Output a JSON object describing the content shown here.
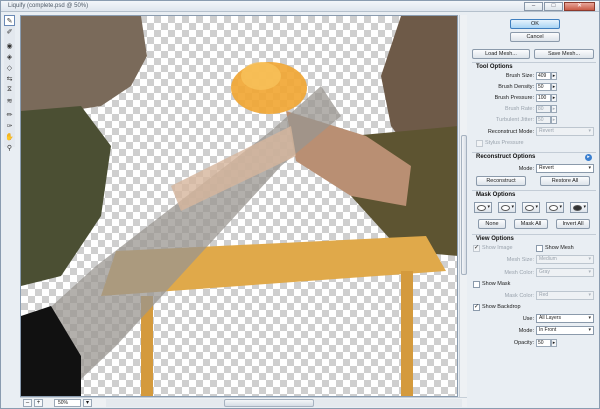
{
  "window": {
    "title": "Liquify (complete.psd @ 50%)",
    "minimize": "–",
    "maximize": "□",
    "close": "✕"
  },
  "toolbox": {
    "tools": [
      "forward-warp",
      "reconstruct",
      "twirl-clockwise",
      "pucker",
      "bloat",
      "push-left",
      "mirror",
      "turbulence",
      "freeze-mask",
      "thaw-mask",
      "hand",
      "zoom"
    ],
    "glyphs": [
      "✎",
      "✐",
      "◉",
      "◈",
      "◇",
      "⇆",
      "⧖",
      "≋",
      "✏",
      "✑",
      "✋",
      "⚲"
    ]
  },
  "status": {
    "zoom_out": "–",
    "zoom_in": "+",
    "zoom_value": "50%",
    "dropdown": "▾"
  },
  "panel": {
    "ok": "OK",
    "cancel": "Cancel",
    "load_mesh": "Load Mesh...",
    "save_mesh": "Save Mesh...",
    "tool_options": {
      "title": "Tool Options",
      "brush_size_label": "Brush Size:",
      "brush_size": "409",
      "brush_density_label": "Brush Density:",
      "brush_density": "50",
      "brush_pressure_label": "Brush Pressure:",
      "brush_pressure": "100",
      "brush_rate_label": "Brush Rate:",
      "brush_rate": "80",
      "turbulent_jitter_label": "Turbulent Jitter:",
      "turbulent_jitter": "50",
      "reconstruct_mode_label": "Reconstruct Mode:",
      "reconstruct_mode": "Revert",
      "stylus_pressure": "Stylus Pressure"
    },
    "reconstruct_options": {
      "title": "Reconstruct Options",
      "mode_label": "Mode:",
      "mode": "Revert",
      "reconstruct": "Reconstruct",
      "restore_all": "Restore All"
    },
    "mask_options": {
      "title": "Mask Options",
      "none": "None",
      "mask_all": "Mask All",
      "invert_all": "Invert All"
    },
    "view_options": {
      "title": "View Options",
      "show_image": "Show Image",
      "show_mesh": "Show Mesh",
      "mesh_size_label": "Mesh Size:",
      "mesh_size": "Medium",
      "mesh_color_label": "Mesh Color:",
      "mesh_color": "Gray",
      "show_mask": "Show Mask",
      "mask_color_label": "Mask Color:",
      "mask_color": "Red",
      "show_backdrop": "Show Backdrop",
      "use_label": "Use:",
      "use": "All Layers",
      "mode_label": "Mode:",
      "mode": "In Front",
      "opacity_label": "Opacity:",
      "opacity": "50"
    }
  },
  "colors": {
    "accent": "#3f7fbf",
    "panel_bg": "#e9eef3",
    "checker": "#cfcfcf"
  }
}
